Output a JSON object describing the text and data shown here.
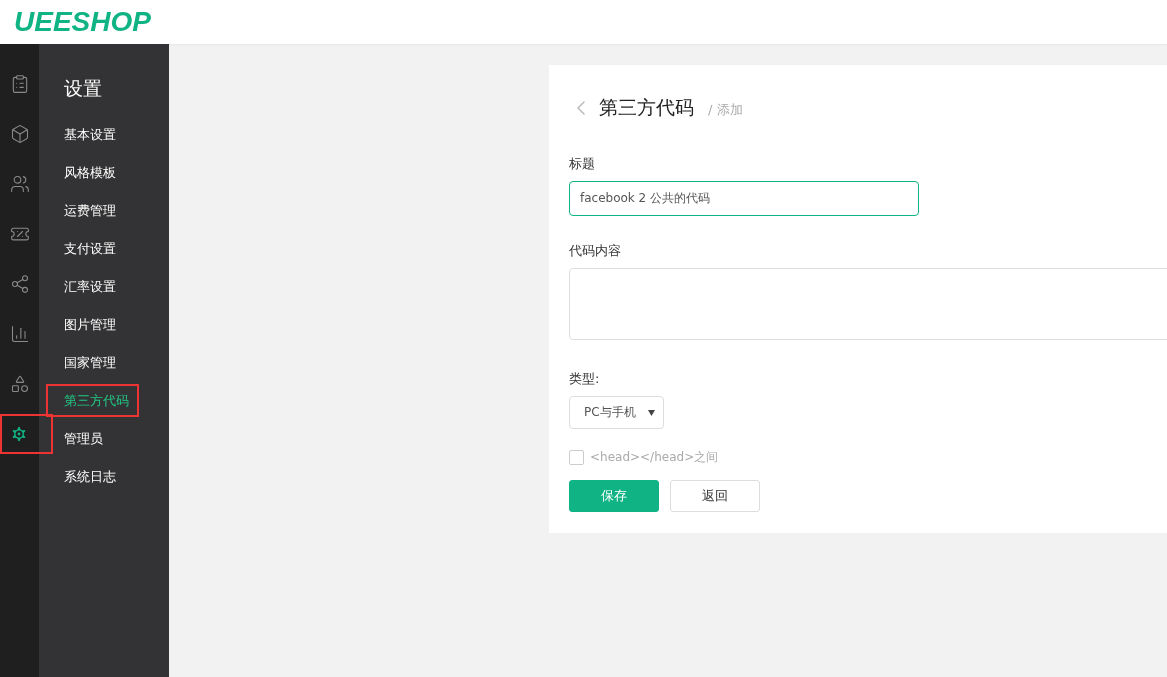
{
  "header": {
    "logo": "UEESHOP"
  },
  "rail": {
    "items": [
      {
        "kind": "clipboard",
        "selected": false,
        "highlighted": false
      },
      {
        "kind": "box",
        "selected": false,
        "highlighted": false
      },
      {
        "kind": "users",
        "selected": false,
        "highlighted": false
      },
      {
        "kind": "coupon",
        "selected": false,
        "highlighted": false
      },
      {
        "kind": "nodes",
        "selected": false,
        "highlighted": false
      },
      {
        "kind": "chart",
        "selected": false,
        "highlighted": false
      },
      {
        "kind": "apps",
        "selected": false,
        "highlighted": false
      },
      {
        "kind": "settings",
        "selected": true,
        "highlighted": true
      }
    ]
  },
  "menu": {
    "title": "设置",
    "items": [
      {
        "label": "基本设置",
        "selected": false,
        "highlighted": false
      },
      {
        "label": "风格模板",
        "selected": false,
        "highlighted": false
      },
      {
        "label": "运费管理",
        "selected": false,
        "highlighted": false
      },
      {
        "label": "支付设置",
        "selected": false,
        "highlighted": false
      },
      {
        "label": "汇率设置",
        "selected": false,
        "highlighted": false
      },
      {
        "label": "图片管理",
        "selected": false,
        "highlighted": false
      },
      {
        "label": "国家管理",
        "selected": false,
        "highlighted": false
      },
      {
        "label": "第三方代码",
        "selected": true,
        "highlighted": true
      },
      {
        "label": "管理员",
        "selected": false,
        "highlighted": false
      },
      {
        "label": "系统日志",
        "selected": false,
        "highlighted": false
      }
    ]
  },
  "form": {
    "title": "第三方代码",
    "crumb": "/ 添加",
    "title_label": "标题",
    "title_value": "facebook 2 公共的代码",
    "code_label": "代码内容",
    "type_label": "类型:",
    "type_value": "PC与手机",
    "head_checkbox": {
      "label": "<head></head>之间",
      "checked": false
    },
    "buttons": [
      {
        "kind": "primary",
        "label": "保存"
      },
      {
        "kind": "secondary",
        "label": "返回"
      }
    ]
  }
}
